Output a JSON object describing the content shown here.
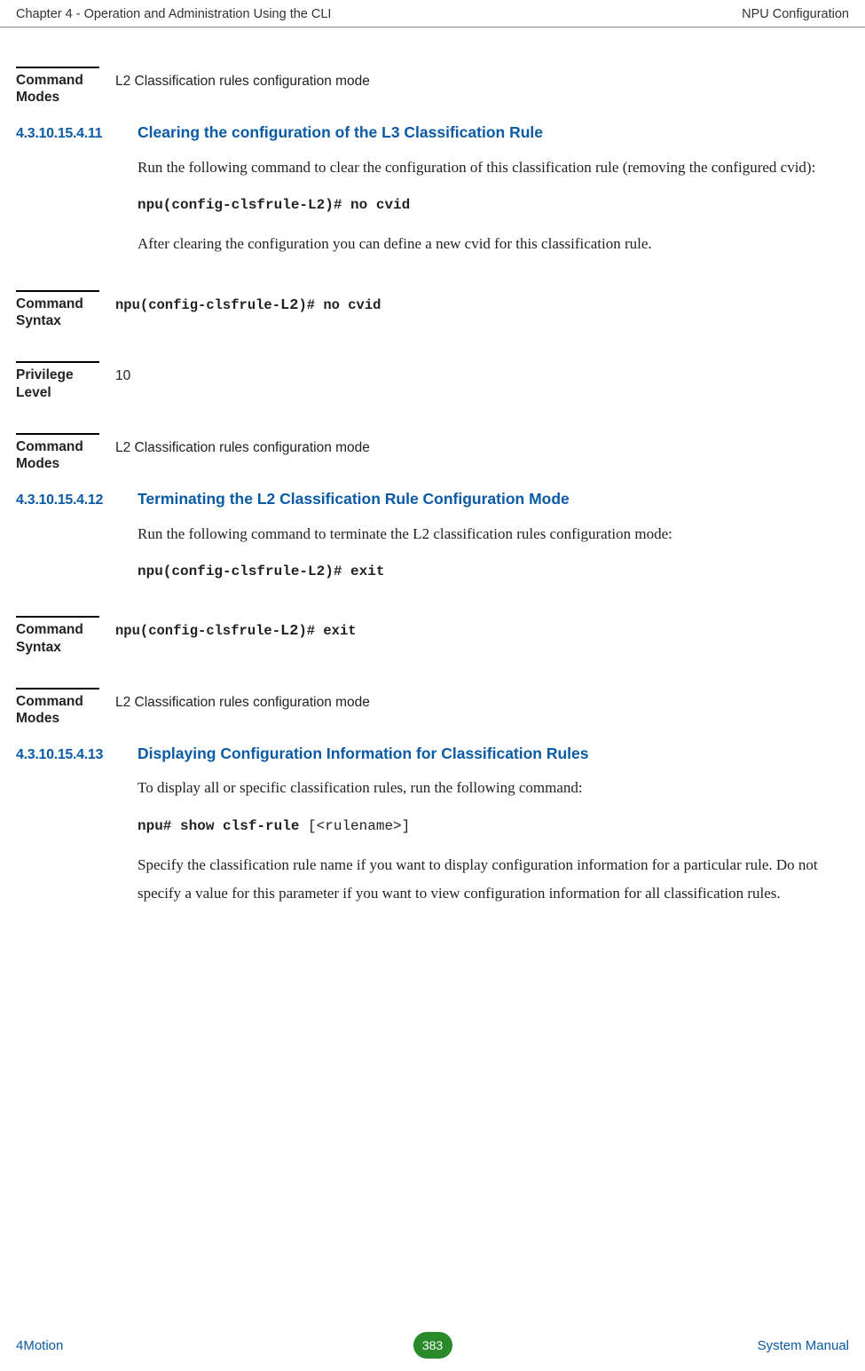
{
  "header": {
    "left": "Chapter 4 - Operation and Administration Using the CLI",
    "right": "NPU Configuration"
  },
  "block_top": {
    "label": "Command Modes",
    "value": "L2 Classification rules configuration mode"
  },
  "sec11": {
    "num": "4.3.10.15.4.11",
    "title": "Clearing the configuration of the L3 Classification Rule",
    "para1": "Run the following command to clear the configuration of this classification rule (removing the configured cvid):",
    "cmd": "npu(config-clsfrule-L2)# no cvid",
    "para2": "After clearing the configuration you can define a new cvid for this classification rule.",
    "syntax_label": "Command Syntax",
    "syntax_value_a": "npu(config-clsfrule-",
    "syntax_value_b": "L2",
    "syntax_value_c": ")# no cvid",
    "priv_label": "Privilege Level",
    "priv_value": "10",
    "modes_label": "Command Modes",
    "modes_value": "L2 Classification rules configuration mode"
  },
  "sec12": {
    "num": "4.3.10.15.4.12",
    "title": "Terminating the L2 Classification Rule Configuration Mode",
    "para1": "Run the following command to terminate the L2 classification rules configuration mode:",
    "cmd": "npu(config-clsfrule-L2)# exit",
    "syntax_label": "Command Syntax",
    "syntax_value_a": "npu(config-clsfrule-",
    "syntax_value_b": "L2",
    "syntax_value_c": ")# exit",
    "modes_label": "Command Modes",
    "modes_value": "L2 Classification rules configuration mode"
  },
  "sec13": {
    "num": "4.3.10.15.4.13",
    "title": "Displaying Configuration Information for Classification Rules",
    "para1": " To display all or specific classification rules, run the following command:",
    "cmd_b": "npu# show clsf-rule ",
    "cmd_nb": "[<rulename>]",
    "para2": "Specify the classification rule name if you want to display configuration information for a particular rule. Do not specify a value for this parameter if you want to view configuration information for all classification rules."
  },
  "footer": {
    "left": "4Motion",
    "page": "383",
    "right": "System Manual"
  }
}
